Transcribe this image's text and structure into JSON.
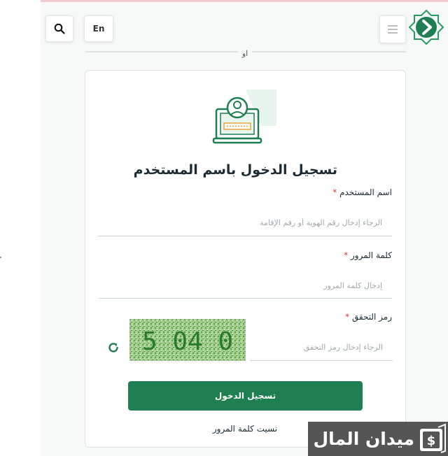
{
  "header": {
    "language_label": "En"
  },
  "divider": {
    "or_label": "او"
  },
  "login_form": {
    "title": "تسجيل الدخول باسم المستخدم",
    "username": {
      "label": "اسم المستخدم",
      "placeholder": "الرجاء إدخال رقم الهوية أو رقم الإقامة",
      "value": ""
    },
    "password": {
      "label": "كلمة المرور",
      "placeholder": "إدخال كلمة المرور",
      "value": ""
    },
    "captcha": {
      "label": "رمز التحقق",
      "placeholder": "الرجاء إدخال رمز التحقق",
      "value": "",
      "image_text": "5 04 0"
    },
    "required_mark": "*",
    "submit_label": "تسجيل الدخول",
    "forgot_password_label": "نسيت كلمة المرور"
  },
  "watermark": {
    "text": "ميدان المال"
  },
  "colors": {
    "primary_green": "#1f7f52",
    "required_red": "#d33c3c"
  },
  "icons": [
    "search-icon",
    "menu-icon",
    "logo-chevron-icon",
    "laptop-user-icon",
    "refresh-icon",
    "wallet-icon"
  ]
}
